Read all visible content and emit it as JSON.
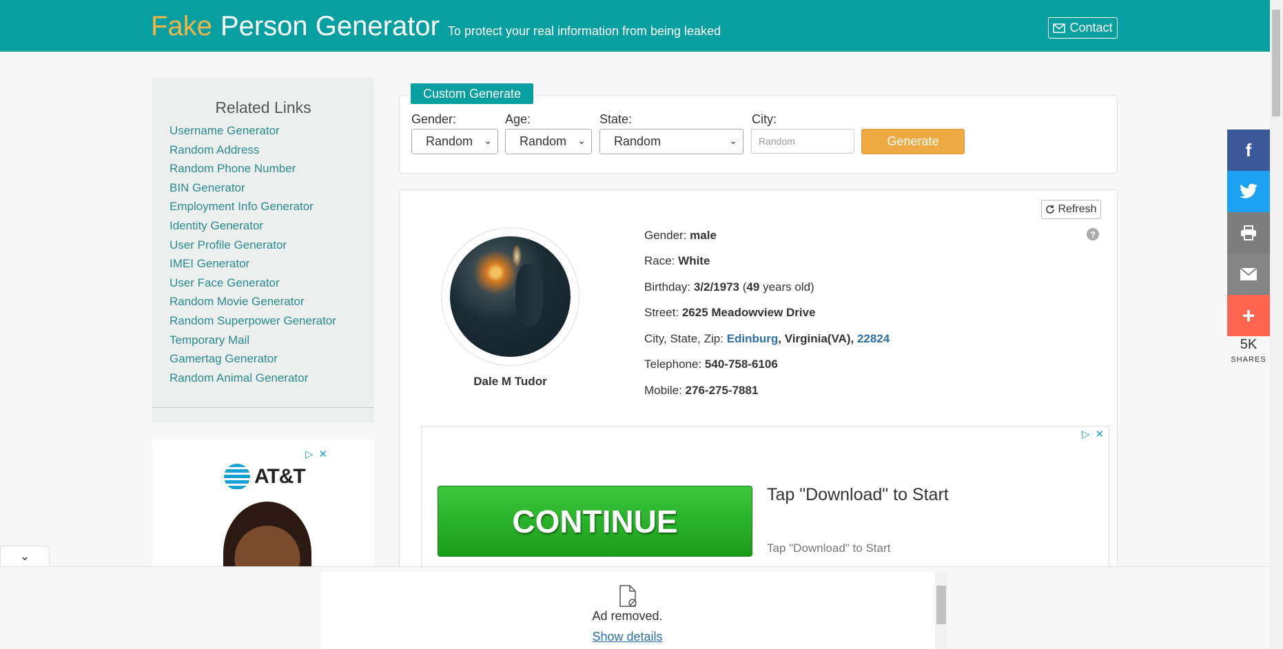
{
  "header": {
    "logo_fake": "Fake",
    "logo_main": "Person Generator",
    "tagline": "To protect your real information from being leaked",
    "contact_label": "Contact",
    "bg_color": "#089fa1",
    "accent_color": "#f0b64a"
  },
  "sidebar": {
    "title": "Related Links",
    "links": [
      "Username Generator",
      "Random Address",
      "Random Phone Number",
      "BIN Generator",
      "Employment Info Generator",
      "Identity Generator",
      "User Profile Generator",
      "IMEI Generator",
      "User Face Generator",
      "Random Movie Generator",
      "Random Superpower Generator",
      "Temporary Mail",
      "Gamertag Generator",
      "Random Animal Generator"
    ]
  },
  "side_ad": {
    "brand": "AT&T",
    "ad_choice_icon": "ad-choices-icon",
    "close_icon": "close-icon"
  },
  "custom_generate": {
    "tab_label": "Custom Generate",
    "gender_label": "Gender:",
    "gender_value": "Random",
    "age_label": "Age:",
    "age_value": "Random",
    "state_label": "State:",
    "state_value": "Random",
    "city_label": "City:",
    "city_placeholder": "Random",
    "generate_label": "Generate"
  },
  "result": {
    "refresh_label": "Refresh",
    "help_glyph": "?",
    "name": "Dale M Tudor",
    "gender_label": "Gender:",
    "gender": "male",
    "race_label": "Race:",
    "race": "White",
    "birthday_label": "Birthday:",
    "birthday": "3/2/1973",
    "age_open": "(",
    "age": "49",
    "age_suffix": "years old)",
    "street_label": "Street:",
    "street": "2625 Meadowview Drive",
    "csz_label": "City, State, Zip:",
    "city": "Edinburg",
    "state": "Virginia(VA)",
    "zip": "22824",
    "telephone_label": "Telephone:",
    "telephone": "540-758-6106",
    "mobile_label": "Mobile:",
    "mobile": "276-275-7881"
  },
  "inner_ad": {
    "button_label": "CONTINUE",
    "title": "Tap \"Download\" to Start",
    "subtitle": "Tap \"Download\" to Start"
  },
  "share": {
    "count": "5K",
    "label": "SHARES",
    "buttons": [
      {
        "icon": "facebook-icon",
        "glyph": "f",
        "color": "#3b5998"
      },
      {
        "icon": "twitter-icon",
        "glyph": "🐦",
        "color": "#1da1f2"
      },
      {
        "icon": "print-icon",
        "glyph": "⎙",
        "color": "#7d7d7d"
      },
      {
        "icon": "email-icon",
        "glyph": "✉",
        "color": "#848484"
      },
      {
        "icon": "more-icon",
        "glyph": "+",
        "color": "#ff6550"
      }
    ]
  },
  "bottom": {
    "removed_text": "Ad removed.",
    "details_link": "Show details"
  }
}
